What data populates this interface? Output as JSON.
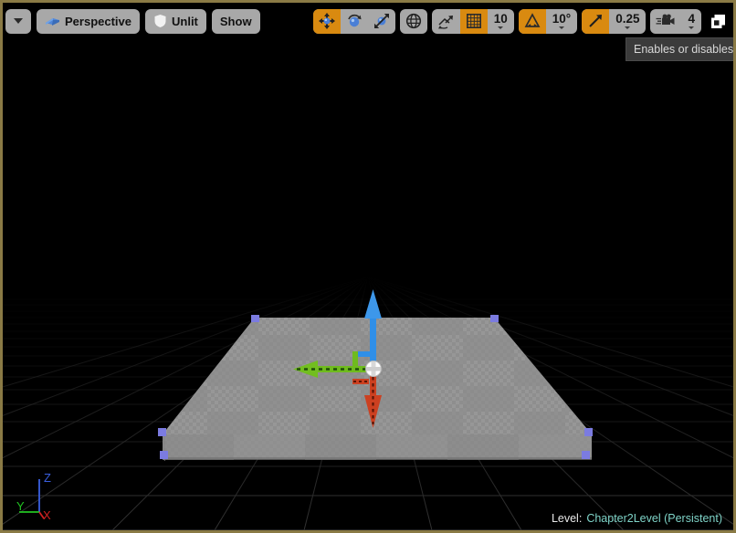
{
  "viewport": {
    "border_color": "#8a7a45",
    "background_color": "#000000"
  },
  "toolbar_left": {
    "viewport_menu": {
      "icon": "chevron-down-icon",
      "label": ""
    },
    "view_mode": {
      "icon": "perspective-camera-icon",
      "label": "Perspective"
    },
    "lighting_mode": {
      "icon": "shield-lighting-icon",
      "label": "Unlit"
    },
    "show_menu": {
      "label": "Show"
    }
  },
  "toolbar_right": {
    "transform_modes": [
      {
        "name": "translate-mode",
        "icon": "move-arrows-icon",
        "active": true
      },
      {
        "name": "rotate-mode",
        "icon": "rotate-globe-icon",
        "active": false
      },
      {
        "name": "scale-mode",
        "icon": "scale-arrows-icon",
        "active": false
      }
    ],
    "coordinate_system": {
      "icon": "world-globe-icon",
      "active": false
    },
    "surface_snap": {
      "icon": "surface-snap-icon",
      "active": false
    },
    "grid_snap": {
      "icon": "grid-snap-icon",
      "active": true
    },
    "grid_size": {
      "value": "10"
    },
    "rotation_snap": {
      "icon": "angle-snap-icon",
      "active": true
    },
    "rotation_snap_value": {
      "value": "10°"
    },
    "scale_snap": {
      "icon": "scale-snap-icon",
      "active": true
    },
    "scale_snap_value": {
      "value": "0.25"
    },
    "camera_speed": {
      "icon": "camera-speed-icon",
      "value": "4"
    },
    "maximize_viewport": {
      "icon": "maximize-restore-icon"
    }
  },
  "tooltip": {
    "text": "Enables or disables sna"
  },
  "status_bar": {
    "level_key": "Level:",
    "level_value": "Chapter2Level (Persistent)",
    "level_value_color": "#7fd4c8"
  },
  "axis_indicator": {
    "z": {
      "label": "Z",
      "color": "#3a5fe0"
    },
    "y": {
      "label": "Y",
      "color": "#22c422"
    },
    "x": {
      "label": "X",
      "color": "#d02020"
    }
  },
  "gizmo": {
    "type": "translate-gizmo",
    "axes": [
      {
        "name": "z-axis-arrow",
        "color": "#2f8fe8",
        "direction": "up"
      },
      {
        "name": "y-axis-arrow",
        "color": "#6fbb1e",
        "direction": "left"
      },
      {
        "name": "x-axis-arrow",
        "color": "#cc4020",
        "direction": "down-front"
      }
    ],
    "pivot": {
      "name": "pivot-sphere",
      "color": "#ffffff"
    }
  },
  "scene": {
    "selected_actor": {
      "name": "floor-mesh",
      "surface": "checkerboard",
      "checker_color_a": "#9a9a9a",
      "checker_color_b": "#868686",
      "selection_handle_color": "#7b7be0"
    },
    "grid_color": "#2a2a2a"
  }
}
